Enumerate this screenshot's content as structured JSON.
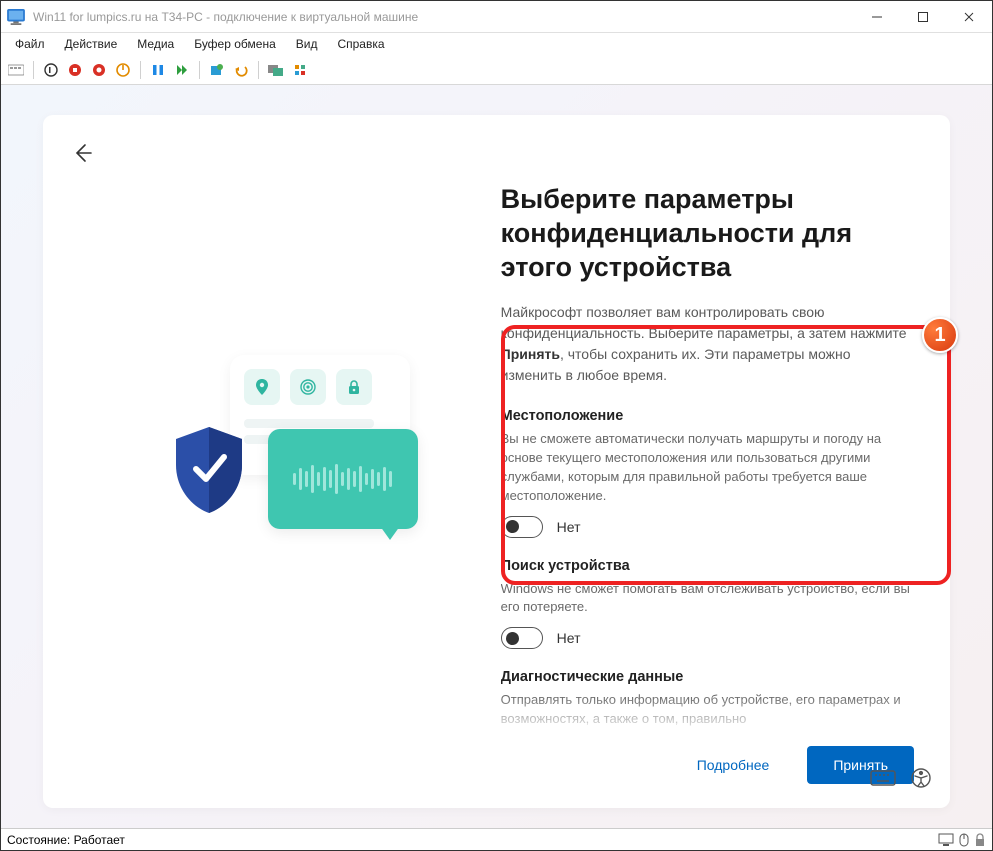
{
  "window": {
    "title": "Win11 for lumpics.ru на T34-PC - подключение к виртуальной машине"
  },
  "menus": {
    "file": "Файл",
    "action": "Действие",
    "media": "Медиа",
    "clipboard": "Буфер обмена",
    "view": "Вид",
    "help": "Справка"
  },
  "oobe": {
    "heading": "Выберите параметры конфиденциальности для этого устройства",
    "intro_pre": "Майкрософт позволяет вам контролировать свою конфиденциальность. Выберите параметры, а затем нажмите ",
    "intro_bold": "Принять",
    "intro_post": ", чтобы сохранить их. Эти параметры можно изменить в любое время.",
    "settings": {
      "location": {
        "title": "Местоположение",
        "desc": "Вы не сможете автоматически получать маршруты и погоду на основе текущего местоположения или пользоваться другими службами, которым для правильной работы требуется ваше местоположение.",
        "state": "Нет"
      },
      "find_device": {
        "title": "Поиск устройства",
        "desc": "Windows не сможет помогать вам отслеживать устройство, если вы его потеряете.",
        "state": "Нет"
      },
      "diagnostics": {
        "title": "Диагностические данные",
        "desc": "Отправлять только информацию об устройстве, его параметрах и возможностях, а также о том, правильно"
      }
    },
    "more_btn": "Подробнее",
    "accept_btn": "Принять"
  },
  "annotation": {
    "badge": "1"
  },
  "status": {
    "label": "Состояние:",
    "value": "Работает"
  }
}
